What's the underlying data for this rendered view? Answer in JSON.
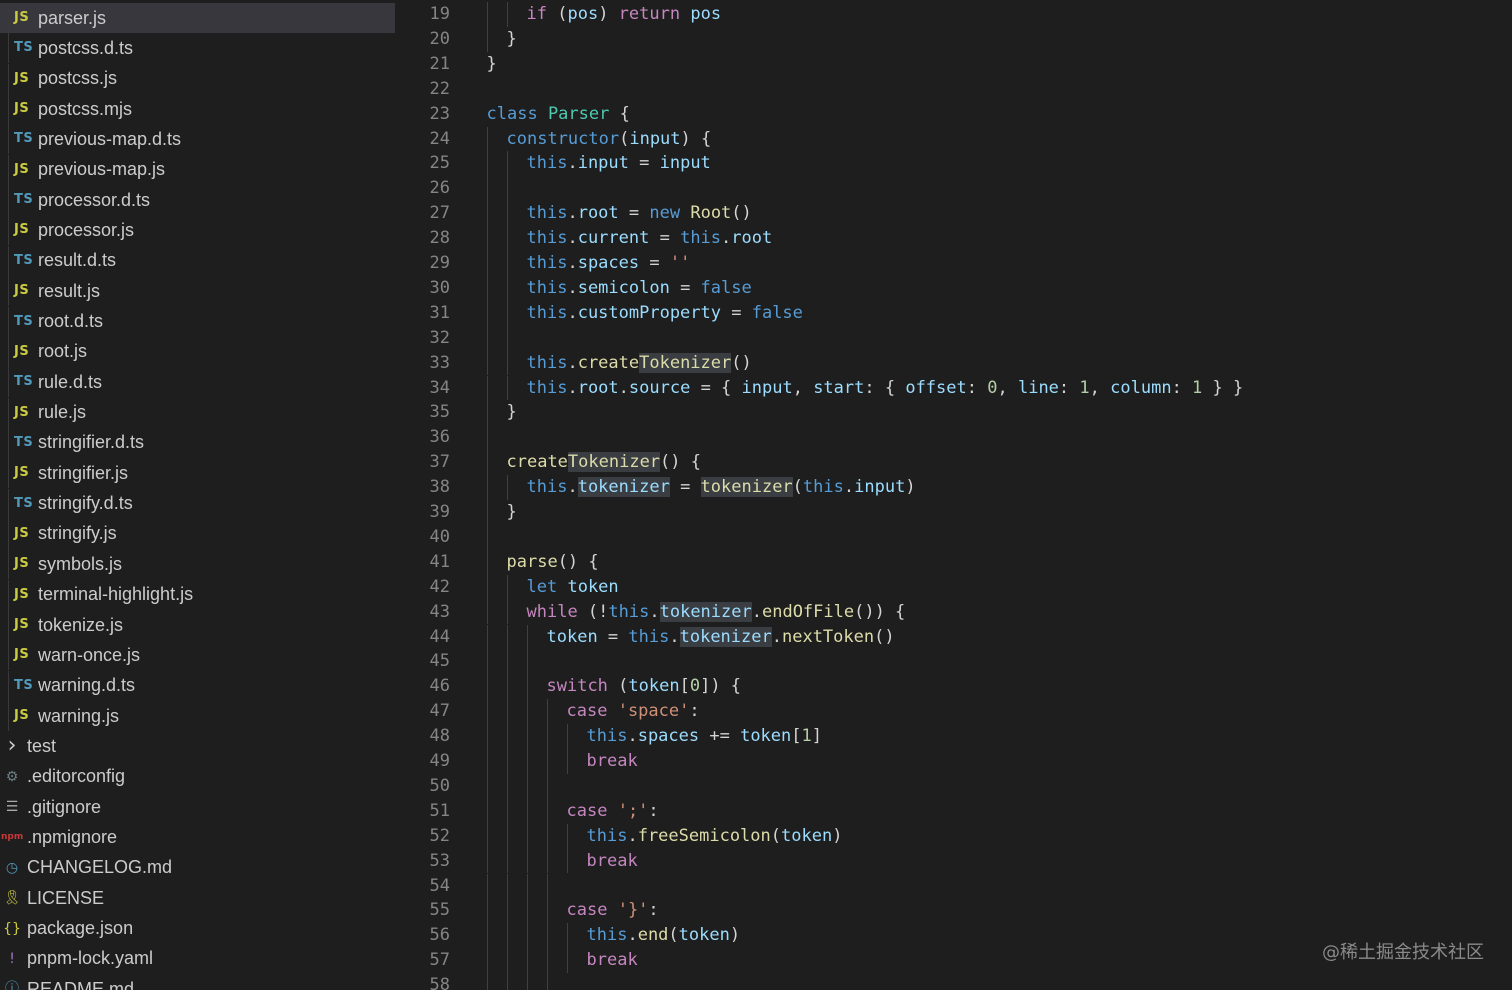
{
  "explorer": {
    "files": [
      {
        "type": "JS",
        "name": "parser.js",
        "selected": true
      },
      {
        "type": "TS",
        "name": "postcss.d.ts"
      },
      {
        "type": "JS",
        "name": "postcss.js"
      },
      {
        "type": "JS",
        "name": "postcss.mjs"
      },
      {
        "type": "TS",
        "name": "previous-map.d.ts"
      },
      {
        "type": "JS",
        "name": "previous-map.js"
      },
      {
        "type": "TS",
        "name": "processor.d.ts"
      },
      {
        "type": "JS",
        "name": "processor.js"
      },
      {
        "type": "TS",
        "name": "result.d.ts"
      },
      {
        "type": "JS",
        "name": "result.js"
      },
      {
        "type": "TS",
        "name": "root.d.ts"
      },
      {
        "type": "JS",
        "name": "root.js"
      },
      {
        "type": "TS",
        "name": "rule.d.ts"
      },
      {
        "type": "JS",
        "name": "rule.js"
      },
      {
        "type": "TS",
        "name": "stringifier.d.ts"
      },
      {
        "type": "JS",
        "name": "stringifier.js"
      },
      {
        "type": "TS",
        "name": "stringify.d.ts"
      },
      {
        "type": "JS",
        "name": "stringify.js"
      },
      {
        "type": "JS",
        "name": "symbols.js"
      },
      {
        "type": "JS",
        "name": "terminal-highlight.js"
      },
      {
        "type": "JS",
        "name": "tokenize.js"
      },
      {
        "type": "JS",
        "name": "warn-once.js"
      },
      {
        "type": "TS",
        "name": "warning.d.ts"
      },
      {
        "type": "JS",
        "name": "warning.js"
      }
    ],
    "root_items": [
      {
        "icon": "chevron-right-icon",
        "glyph": "›",
        "color": "#cccccc",
        "name": "test"
      },
      {
        "icon": "gear-icon",
        "glyph": "⚙",
        "color": "#6d8086",
        "name": ".editorconfig"
      },
      {
        "icon": "lines-icon",
        "glyph": "☰",
        "color": "#aaaaaa",
        "name": ".gitignore"
      },
      {
        "icon": "npm-icon",
        "glyph": "npm",
        "color": "#cb3837",
        "name": ".npmignore"
      },
      {
        "icon": "clock-icon",
        "glyph": "◷",
        "color": "#519aba",
        "name": "CHANGELOG.md"
      },
      {
        "icon": "license-icon",
        "glyph": "🎗",
        "color": "#cbcb41",
        "name": "LICENSE"
      },
      {
        "icon": "braces-icon",
        "glyph": "{}",
        "color": "#cbcb41",
        "name": "package.json"
      },
      {
        "icon": "exclamation-icon",
        "glyph": "!",
        "color": "#a074c4",
        "name": "pnpm-lock.yaml"
      },
      {
        "icon": "info-icon",
        "glyph": "ⓘ",
        "color": "#519aba",
        "name": "README.md"
      }
    ]
  },
  "editor": {
    "first_line": 19,
    "lines": [
      {
        "n": "19",
        "indent": 2,
        "tokens": [
          [
            "ctl",
            "if"
          ],
          [
            "pun",
            " ("
          ],
          [
            "var",
            "pos"
          ],
          [
            "pun",
            ") "
          ],
          [
            "ctl",
            "return"
          ],
          [
            "pun",
            " "
          ],
          [
            "var",
            "pos"
          ]
        ]
      },
      {
        "n": "20",
        "indent": 1,
        "tokens": [
          [
            "pun",
            "}"
          ]
        ]
      },
      {
        "n": "21",
        "indent": 0,
        "tokens": [
          [
            "pun",
            "}"
          ]
        ]
      },
      {
        "n": "22",
        "indent": 0,
        "tokens": []
      },
      {
        "n": "23",
        "indent": 0,
        "tokens": [
          [
            "kw",
            "class"
          ],
          [
            "pun",
            " "
          ],
          [
            "cls",
            "Parser"
          ],
          [
            "pun",
            " {"
          ]
        ]
      },
      {
        "n": "24",
        "indent": 1,
        "tokens": [
          [
            "kw",
            "constructor"
          ],
          [
            "pun",
            "("
          ],
          [
            "var",
            "input"
          ],
          [
            "pun",
            ") {"
          ]
        ]
      },
      {
        "n": "25",
        "indent": 2,
        "tokens": [
          [
            "this",
            "this"
          ],
          [
            "pun",
            "."
          ],
          [
            "var",
            "input"
          ],
          [
            "pun",
            " = "
          ],
          [
            "var",
            "input"
          ]
        ]
      },
      {
        "n": "26",
        "indent": 2,
        "tokens": []
      },
      {
        "n": "27",
        "indent": 2,
        "tokens": [
          [
            "this",
            "this"
          ],
          [
            "pun",
            "."
          ],
          [
            "var",
            "root"
          ],
          [
            "pun",
            " = "
          ],
          [
            "kw",
            "new"
          ],
          [
            "pun",
            " "
          ],
          [
            "fn",
            "Root"
          ],
          [
            "pun",
            "()"
          ]
        ]
      },
      {
        "n": "28",
        "indent": 2,
        "tokens": [
          [
            "this",
            "this"
          ],
          [
            "pun",
            "."
          ],
          [
            "var",
            "current"
          ],
          [
            "pun",
            " = "
          ],
          [
            "this",
            "this"
          ],
          [
            "pun",
            "."
          ],
          [
            "var",
            "root"
          ]
        ]
      },
      {
        "n": "29",
        "indent": 2,
        "tokens": [
          [
            "this",
            "this"
          ],
          [
            "pun",
            "."
          ],
          [
            "var",
            "spaces"
          ],
          [
            "pun",
            " = "
          ],
          [
            "str",
            "''"
          ]
        ]
      },
      {
        "n": "30",
        "indent": 2,
        "tokens": [
          [
            "this",
            "this"
          ],
          [
            "pun",
            "."
          ],
          [
            "var",
            "semicolon"
          ],
          [
            "pun",
            " = "
          ],
          [
            "kw",
            "false"
          ]
        ]
      },
      {
        "n": "31",
        "indent": 2,
        "tokens": [
          [
            "this",
            "this"
          ],
          [
            "pun",
            "."
          ],
          [
            "var",
            "customProperty"
          ],
          [
            "pun",
            " = "
          ],
          [
            "kw",
            "false"
          ]
        ]
      },
      {
        "n": "32",
        "indent": 2,
        "tokens": []
      },
      {
        "n": "33",
        "indent": 2,
        "tokens": [
          [
            "this",
            "this"
          ],
          [
            "pun",
            "."
          ],
          [
            "fn",
            "create"
          ],
          [
            "fnhl",
            "Tokenizer"
          ],
          [
            "pun",
            "()"
          ]
        ]
      },
      {
        "n": "34",
        "indent": 2,
        "tokens": [
          [
            "this",
            "this"
          ],
          [
            "pun",
            "."
          ],
          [
            "var",
            "root"
          ],
          [
            "pun",
            "."
          ],
          [
            "var",
            "source"
          ],
          [
            "pun",
            " = { "
          ],
          [
            "var",
            "input"
          ],
          [
            "pun",
            ", "
          ],
          [
            "var",
            "start"
          ],
          [
            "pun",
            ": { "
          ],
          [
            "var",
            "offset"
          ],
          [
            "pun",
            ": "
          ],
          [
            "num",
            "0"
          ],
          [
            "pun",
            ", "
          ],
          [
            "var",
            "line"
          ],
          [
            "pun",
            ": "
          ],
          [
            "num",
            "1"
          ],
          [
            "pun",
            ", "
          ],
          [
            "var",
            "column"
          ],
          [
            "pun",
            ": "
          ],
          [
            "num",
            "1"
          ],
          [
            "pun",
            " } }"
          ]
        ]
      },
      {
        "n": "35",
        "indent": 1,
        "tokens": [
          [
            "pun",
            "}"
          ]
        ]
      },
      {
        "n": "36",
        "indent": 1,
        "tokens": []
      },
      {
        "n": "37",
        "indent": 1,
        "tokens": [
          [
            "fn",
            "create"
          ],
          [
            "fnhl",
            "Tokenizer"
          ],
          [
            "pun",
            "() {"
          ]
        ]
      },
      {
        "n": "38",
        "indent": 2,
        "tokens": [
          [
            "this",
            "this"
          ],
          [
            "pun",
            "."
          ],
          [
            "varhl",
            "tokenizer"
          ],
          [
            "pun",
            " = "
          ],
          [
            "fnhl",
            "tokenizer"
          ],
          [
            "pun",
            "("
          ],
          [
            "this",
            "this"
          ],
          [
            "pun",
            "."
          ],
          [
            "var",
            "input"
          ],
          [
            "pun",
            ")"
          ]
        ]
      },
      {
        "n": "39",
        "indent": 1,
        "tokens": [
          [
            "pun",
            "}"
          ]
        ]
      },
      {
        "n": "40",
        "indent": 1,
        "tokens": []
      },
      {
        "n": "41",
        "indent": 1,
        "tokens": [
          [
            "fn",
            "parse"
          ],
          [
            "pun",
            "() {"
          ]
        ]
      },
      {
        "n": "42",
        "indent": 2,
        "tokens": [
          [
            "kw",
            "let"
          ],
          [
            "pun",
            " "
          ],
          [
            "var",
            "token"
          ]
        ]
      },
      {
        "n": "43",
        "indent": 2,
        "tokens": [
          [
            "ctl",
            "while"
          ],
          [
            "pun",
            " (!"
          ],
          [
            "this",
            "this"
          ],
          [
            "pun",
            "."
          ],
          [
            "varhl",
            "tokenizer"
          ],
          [
            "pun",
            "."
          ],
          [
            "fn",
            "endOfFile"
          ],
          [
            "pun",
            "()) {"
          ]
        ]
      },
      {
        "n": "44",
        "indent": 3,
        "tokens": [
          [
            "var",
            "token"
          ],
          [
            "pun",
            " = "
          ],
          [
            "this",
            "this"
          ],
          [
            "pun",
            "."
          ],
          [
            "varhl",
            "tokenizer"
          ],
          [
            "pun",
            "."
          ],
          [
            "fn",
            "nextToken"
          ],
          [
            "pun",
            "()"
          ]
        ]
      },
      {
        "n": "45",
        "indent": 3,
        "tokens": []
      },
      {
        "n": "46",
        "indent": 3,
        "tokens": [
          [
            "ctl",
            "switch"
          ],
          [
            "pun",
            " ("
          ],
          [
            "var",
            "token"
          ],
          [
            "pun",
            "["
          ],
          [
            "num",
            "0"
          ],
          [
            "pun",
            "]) {"
          ]
        ]
      },
      {
        "n": "47",
        "indent": 4,
        "tokens": [
          [
            "ctl",
            "case"
          ],
          [
            "pun",
            " "
          ],
          [
            "str",
            "'space'"
          ],
          [
            "pun",
            ":"
          ]
        ]
      },
      {
        "n": "48",
        "indent": 5,
        "tokens": [
          [
            "this",
            "this"
          ],
          [
            "pun",
            "."
          ],
          [
            "var",
            "spaces"
          ],
          [
            "pun",
            " += "
          ],
          [
            "var",
            "token"
          ],
          [
            "pun",
            "["
          ],
          [
            "num",
            "1"
          ],
          [
            "pun",
            "]"
          ]
        ]
      },
      {
        "n": "49",
        "indent": 5,
        "tokens": [
          [
            "ctl",
            "break"
          ]
        ]
      },
      {
        "n": "50",
        "indent": 4,
        "tokens": []
      },
      {
        "n": "51",
        "indent": 4,
        "tokens": [
          [
            "ctl",
            "case"
          ],
          [
            "pun",
            " "
          ],
          [
            "str",
            "';'"
          ],
          [
            "pun",
            ":"
          ]
        ]
      },
      {
        "n": "52",
        "indent": 5,
        "tokens": [
          [
            "this",
            "this"
          ],
          [
            "pun",
            "."
          ],
          [
            "fn",
            "freeSemicolon"
          ],
          [
            "pun",
            "("
          ],
          [
            "var",
            "token"
          ],
          [
            "pun",
            ")"
          ]
        ]
      },
      {
        "n": "53",
        "indent": 5,
        "tokens": [
          [
            "ctl",
            "break"
          ]
        ]
      },
      {
        "n": "54",
        "indent": 4,
        "tokens": []
      },
      {
        "n": "55",
        "indent": 4,
        "tokens": [
          [
            "ctl",
            "case"
          ],
          [
            "pun",
            " "
          ],
          [
            "str",
            "'}'"
          ],
          [
            "pun",
            ":"
          ]
        ]
      },
      {
        "n": "56",
        "indent": 5,
        "tokens": [
          [
            "this",
            "this"
          ],
          [
            "pun",
            "."
          ],
          [
            "fn",
            "end"
          ],
          [
            "pun",
            "("
          ],
          [
            "var",
            "token"
          ],
          [
            "pun",
            ")"
          ]
        ]
      },
      {
        "n": "57",
        "indent": 5,
        "tokens": [
          [
            "ctl",
            "break"
          ]
        ]
      },
      {
        "n": "58",
        "indent": 4,
        "tokens": []
      }
    ]
  },
  "watermark": "@稀土掘金技术社区"
}
